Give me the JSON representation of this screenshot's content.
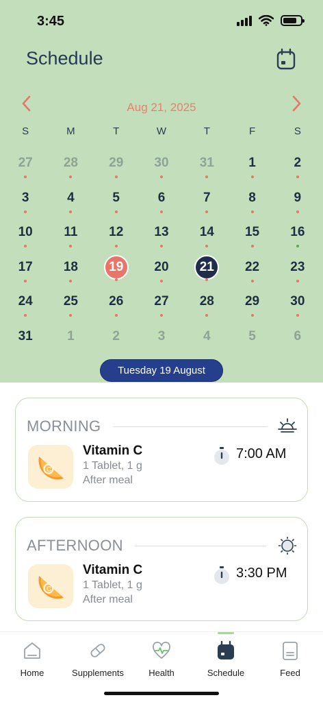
{
  "status": {
    "time": "3:45"
  },
  "header": {
    "title": "Schedule"
  },
  "calendar": {
    "month_label": "Aug 21, 2025",
    "weekdays": [
      "S",
      "M",
      "T",
      "W",
      "T",
      "F",
      "S"
    ],
    "days": [
      {
        "n": "27",
        "muted": true,
        "dot": "#e8756a"
      },
      {
        "n": "28",
        "muted": true,
        "dot": "#e8756a"
      },
      {
        "n": "29",
        "muted": true,
        "dot": "#e8756a"
      },
      {
        "n": "30",
        "muted": true,
        "dot": "#e8756a"
      },
      {
        "n": "31",
        "muted": true,
        "dot": "#e8756a"
      },
      {
        "n": "1",
        "dot": "#e8756a"
      },
      {
        "n": "2",
        "dot": "#e8756a"
      },
      {
        "n": "3",
        "dot": "#e8756a"
      },
      {
        "n": "4",
        "dot": "#e8756a"
      },
      {
        "n": "5",
        "dot": "#e8756a"
      },
      {
        "n": "6",
        "dot": "#e8756a"
      },
      {
        "n": "7",
        "dot": "#e8756a"
      },
      {
        "n": "8",
        "dot": "#e8756a"
      },
      {
        "n": "9",
        "dot": "#e8756a"
      },
      {
        "n": "10",
        "dot": "#e8756a"
      },
      {
        "n": "11",
        "dot": "#e8756a"
      },
      {
        "n": "12",
        "dot": "#e8756a"
      },
      {
        "n": "13",
        "dot": "#e8756a"
      },
      {
        "n": "14",
        "dot": "#e8756a"
      },
      {
        "n": "15",
        "dot": "#e8756a"
      },
      {
        "n": "16",
        "dot": "#4caf50"
      },
      {
        "n": "17",
        "dot": "#e8756a"
      },
      {
        "n": "18",
        "dot": "#e8756a"
      },
      {
        "n": "19",
        "today": true,
        "dot": "#e8756a"
      },
      {
        "n": "20",
        "dot": "#e8756a"
      },
      {
        "n": "21",
        "selected": true,
        "dot": "#e8756a"
      },
      {
        "n": "22",
        "dot": "#e8756a"
      },
      {
        "n": "23",
        "dot": "#e8756a"
      },
      {
        "n": "24",
        "dot": "#e8756a"
      },
      {
        "n": "25",
        "dot": "#e8756a"
      },
      {
        "n": "26",
        "dot": "#e8756a"
      },
      {
        "n": "27",
        "dot": "#e8756a"
      },
      {
        "n": "28",
        "dot": "#e8756a"
      },
      {
        "n": "29",
        "dot": "#e8756a"
      },
      {
        "n": "30",
        "dot": "#e8756a"
      },
      {
        "n": "31"
      },
      {
        "n": "1",
        "muted": true
      },
      {
        "n": "2",
        "muted": true
      },
      {
        "n": "3",
        "muted": true
      },
      {
        "n": "4",
        "muted": true
      },
      {
        "n": "5",
        "muted": true
      },
      {
        "n": "6",
        "muted": true
      }
    ],
    "selected_date_label": "Tuesday 19 August"
  },
  "periods": {
    "morning": {
      "label": "MORNING",
      "icon": "sunrise-icon",
      "med": {
        "name": "Vitamin C",
        "dose": "1 Tablet, 1 g",
        "note": "After meal",
        "time": "7:00 AM"
      }
    },
    "afternoon": {
      "label": "AFTERNOON",
      "icon": "sun-icon",
      "med": {
        "name": "Vitamin C",
        "dose": "1 Tablet, 1 g",
        "note": "After meal",
        "time": "3:30 PM"
      }
    }
  },
  "tabs": {
    "home": "Home",
    "supplements": "Supplements",
    "health": "Health",
    "schedule": "Schedule",
    "feed": "Feed",
    "active": "schedule"
  },
  "colors": {
    "header_bg": "#c3deba",
    "accent": "#e8756a",
    "selected": "#1f2c4a",
    "pill": "#253f8c"
  }
}
